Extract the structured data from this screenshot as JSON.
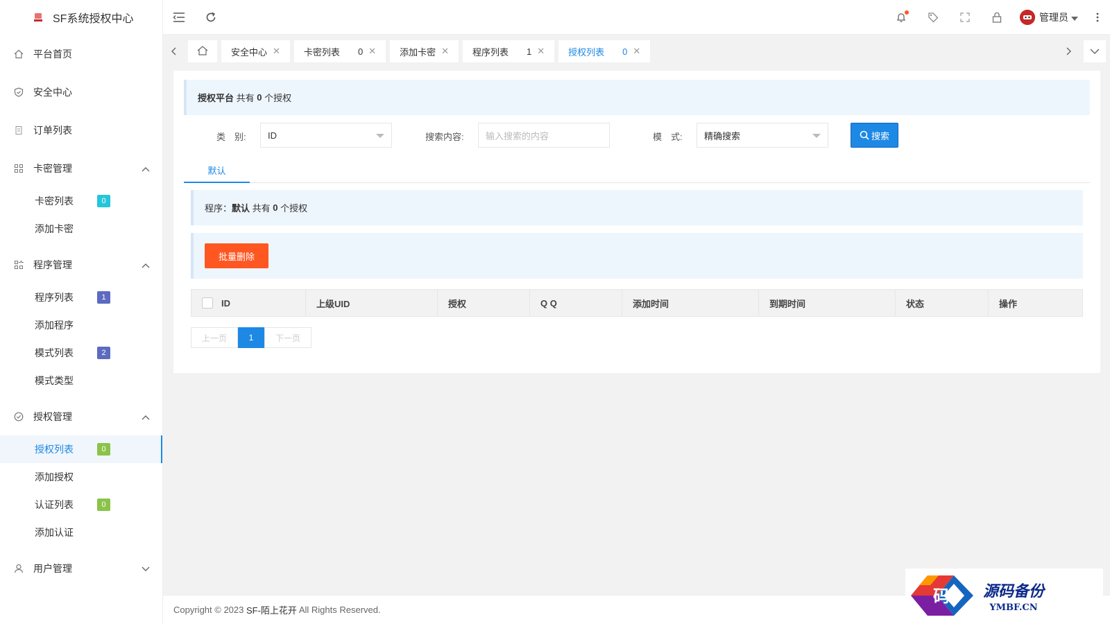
{
  "app": {
    "title": "SF系统授权中心"
  },
  "sidebar": {
    "items": [
      {
        "label": "平台首页",
        "icon": "home-icon"
      },
      {
        "label": "安全中心",
        "icon": "shield-icon"
      },
      {
        "label": "订单列表",
        "icon": "document-icon"
      },
      {
        "label": "卡密管理",
        "icon": "grid-icon",
        "expanded": true,
        "children": [
          {
            "label": "卡密列表",
            "badge": "0",
            "badge_color": "#26c6da"
          },
          {
            "label": "添加卡密"
          }
        ]
      },
      {
        "label": "程序管理",
        "icon": "apps-icon",
        "expanded": true,
        "children": [
          {
            "label": "程序列表",
            "badge": "1",
            "badge_color": "#5c6bc0"
          },
          {
            "label": "添加程序"
          },
          {
            "label": "模式列表",
            "badge": "2",
            "badge_color": "#5c6bc0"
          },
          {
            "label": "模式类型"
          }
        ]
      },
      {
        "label": "授权管理",
        "icon": "check-circle-icon",
        "expanded": true,
        "children": [
          {
            "label": "授权列表",
            "badge": "0",
            "badge_color": "#8bc34a",
            "active": true
          },
          {
            "label": "添加授权"
          },
          {
            "label": "认证列表",
            "badge": "0",
            "badge_color": "#8bc34a"
          },
          {
            "label": "添加认证"
          }
        ]
      },
      {
        "label": "用户管理",
        "icon": "user-icon",
        "expanded": false
      }
    ]
  },
  "header": {
    "user_name": "管理员"
  },
  "tabs": [
    {
      "label": "安全中心",
      "count": ""
    },
    {
      "label": "卡密列表",
      "count": "0"
    },
    {
      "label": "添加卡密",
      "count": ""
    },
    {
      "label": "程序列表",
      "count": "1"
    },
    {
      "label": "授权列表",
      "count": "0",
      "active": true
    }
  ],
  "notice_top": {
    "prefix": "授权平台",
    "text_a": " 共有 ",
    "count": "0",
    "text_b": " 个授权"
  },
  "search": {
    "category_label": "类　别:",
    "category_value": "ID",
    "content_label": "搜索内容:",
    "content_placeholder": "输入搜索的内容",
    "mode_label": "模　式:",
    "mode_value": "精确搜索",
    "button_label": "搜索"
  },
  "subtab": {
    "label": "默认"
  },
  "notice_program": {
    "prefix": "程序：",
    "name": "默认",
    "text_a": " 共有 ",
    "count": "0",
    "text_b": " 个授权"
  },
  "batch_delete_label": "批量删除",
  "table": {
    "columns": [
      "ID",
      "上级UID",
      "授权",
      "Q Q",
      "添加时间",
      "到期时间",
      "状态",
      "操作"
    ]
  },
  "pager": {
    "prev": "上一页",
    "current": "1",
    "next": "下一页"
  },
  "footer": {
    "text": "Copyright © 2023 ",
    "brand": "SF-陌上花开",
    "suffix": " All Rights Reserved."
  },
  "watermark": {
    "cn": "源码备份",
    "en": "YMBF.CN",
    "glyph": "码"
  }
}
